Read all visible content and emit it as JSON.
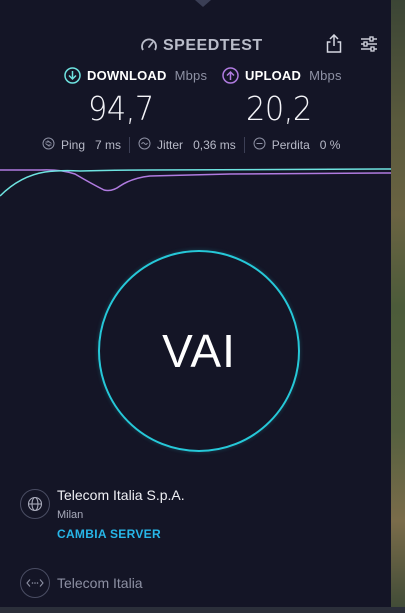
{
  "header": {
    "brand": "SPEEDTEST"
  },
  "download": {
    "label": "DOWNLOAD",
    "unit": "Mbps",
    "value": "94,7"
  },
  "upload": {
    "label": "UPLOAD",
    "unit": "Mbps",
    "value": "20,2"
  },
  "stats": {
    "ping_label": "Ping",
    "ping_value": "7 ms",
    "jitter_label": "Jitter",
    "jitter_value": "0,36 ms",
    "loss_label": "Perdita",
    "loss_value": "0 %"
  },
  "go_button": "VAI",
  "server": {
    "name": "Telecom Italia S.p.A.",
    "city": "Milan",
    "change_label": "CAMBIA SERVER"
  },
  "isp": {
    "name": "Telecom Italia"
  },
  "colors": {
    "background": "#141526",
    "download_accent": "#6ee3e0",
    "upload_accent": "#b07be0",
    "go_ring": "#26c8d8",
    "link": "#27b6e8"
  }
}
